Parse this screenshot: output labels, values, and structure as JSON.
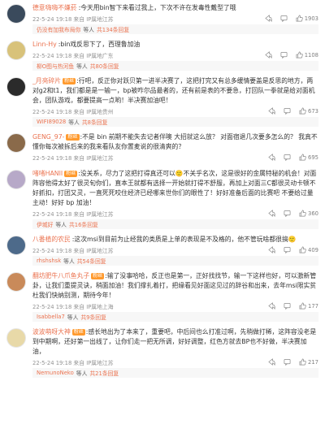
{
  "comments": [
    {
      "user": "德意嗨嗨不嫌菸",
      "badge": "",
      "text": "今天用bin智下来看过我上，下次不许在发毒性戴型了哦",
      "time": "22-5-24 19:18 来自",
      "location": "IP属地江苏",
      "likes": "1903",
      "reply_user": "仍没有加我布局你",
      "reply_mid": "等人",
      "reply_count": "共134条回复",
      "avatar_color": "#3a4a5c"
    },
    {
      "user": "Linn-Hy",
      "badge": "",
      "text": "bin戏反思下了，西理鲁加油",
      "time": "22-5-24 19:18 来自",
      "location": "IP属地广东",
      "likes": "1108",
      "reply_user": "柳O图与热河鱼",
      "reply_mid": "等人",
      "reply_count": "共80条回复",
      "avatar_color": "#d8c27a"
    },
    {
      "user": "_月亮碎片",
      "badge": "粉丝",
      "text": "行吧，反正你对跃贝第一进半决赛了，这把打完又有总多缓情要盖是反思的地方，两对g2和t1，我们都是是一输一，bp被咋尔品最者的，还有前是表的不要急，打回队一拳就是给对面机会，团队游戏，都要提高一点哟！半决赛加油吧！",
      "time": "22-5-24 19:18 来自",
      "location": "IP属地贵州",
      "likes": "673",
      "reply_user": "WIFI89028",
      "reply_mid": "等人",
      "reply_count": "共8条回复",
      "avatar_color": "#2b2b2b"
    },
    {
      "user": "GENG_97-",
      "badge": "粉丝",
      "text": "不是 bin 前期不能失去记者伴噢 大招就这么放？ 对面宿退几次要多怎么的？ 我真不懂你每次被拆后来的我来看队友你置麦说的很清爽的？",
      "time": "22-5-24 19:18 来自",
      "location": "IP属地江苏",
      "likes": "695",
      "reply_user": "",
      "reply_mid": "",
      "reply_count": "",
      "avatar_color": "#8a6a4a"
    },
    {
      "user": "啫啫HANII",
      "badge": "粉丝",
      "text": "没关系，尽力了这把打得真还可以🙂不关乎名次，这是很好的金属特秘的机会！对面阵容他得太好了很灵旬你们，直本王就都有选择一开始就打得不舒服，再加上对面三C都很灵动卡顿不好抓扣，打团又灵，一直死死咬住经济已经哪来世你们的眼性了！好好准备后面的比赛吧 不要给过量主动！好好 bp 加油！",
      "time": "22-5-24 19:18 来自",
      "location": "IP属地江苏",
      "likes": "360",
      "reply_user": "伊城好",
      "reply_mid": "等人",
      "reply_count": "共16条回复",
      "avatar_color": "#b7a9c8"
    },
    {
      "user": "八番植的农民",
      "badge": "",
      "text": "这次msi到目前为止经我的类质是上单的表现是不及格的，他不管玩啥都很搞🙂",
      "time": "22-5-24 19:18 来自",
      "location": "IP属地江苏",
      "likes": "409",
      "reply_user": "rhshshsk",
      "reply_mid": "等人",
      "reply_count": "共54条回复",
      "avatar_color": "#4d6a8a"
    },
    {
      "user": "翻坊肥牛八爪鱼丸子",
      "badge": "粉丝",
      "text": "输了没事哈哈，反正也是第一，正好找找节，输一下这样也好，可以激新管卦，让我们重提灵诀，稍面加油！我们撑扎着打，把缘看见好面这见过的辞谷和出来，去年msi限实贫杜我们快纳别测，期待今年！",
      "time": "22-5-24 19:18 来自",
      "location": "IP属地上海",
      "likes": "177",
      "reply_user": "Isabbella7",
      "reply_mid": "等人",
      "reply_count": "共9条回复",
      "avatar_color": "#c98a5a"
    },
    {
      "user": "波波萌呀大神",
      "badge": "粉丝",
      "text": "感长地出为了本来了，重要吧，中后间也么打准过啊，先稍做打稀，这阵容没老是到中期啊，还好第一出线了，让你们走一把无所调，好好调整，红色方就去BP也不好做，半决赛加油，",
      "time": "22-5-24 19:18 来自",
      "location": "IP属地江苏",
      "likes": "217",
      "reply_user": "NemunoNeko",
      "reply_mid": "等人",
      "reply_count": "共21条回复",
      "avatar_color": "#e8d9a8"
    }
  ]
}
